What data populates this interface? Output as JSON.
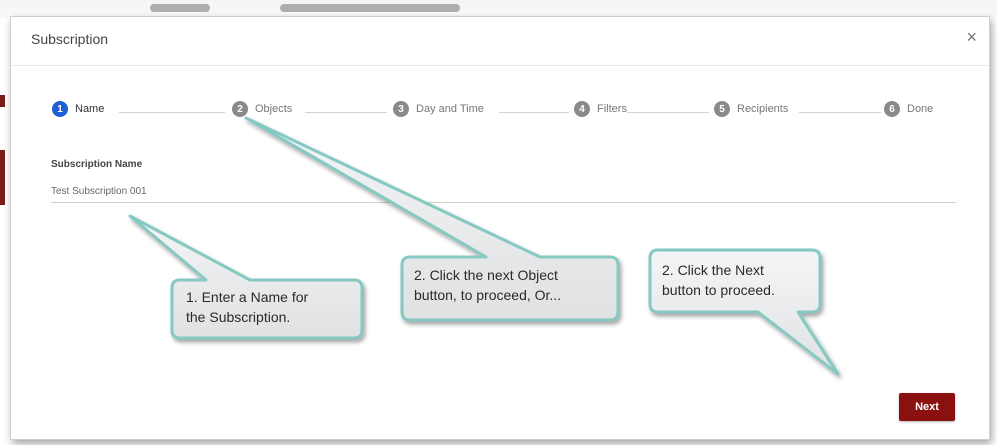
{
  "dialog": {
    "title": "Subscription",
    "close_glyph": "×",
    "steps": [
      {
        "number": "1",
        "label": "Name",
        "active": true
      },
      {
        "number": "2",
        "label": "Objects",
        "active": false
      },
      {
        "number": "3",
        "label": "Day and Time",
        "active": false
      },
      {
        "number": "4",
        "label": "Filters",
        "active": false
      },
      {
        "number": "5",
        "label": "Recipients",
        "active": false
      },
      {
        "number": "6",
        "label": "Done",
        "active": false
      }
    ],
    "subscription_name": {
      "label": "Subscription Name",
      "value": "Test Subscription 001"
    },
    "next_label": "Next"
  },
  "callouts": {
    "name_hint": [
      "1. Enter a Name for",
      "the Subscription."
    ],
    "objects_hint": [
      "2. Click the next Object",
      "button, to proceed, Or..."
    ],
    "next_hint": [
      "2. Click the Next",
      "button to proceed."
    ]
  },
  "colors": {
    "active_step": "#1e5fd6",
    "inactive_step": "#8a8a8a",
    "next_button": "#8b1111",
    "callout_fill": "#e9eaec",
    "callout_border": "#86c8c2"
  },
  "icons": {
    "close": "close-icon"
  }
}
